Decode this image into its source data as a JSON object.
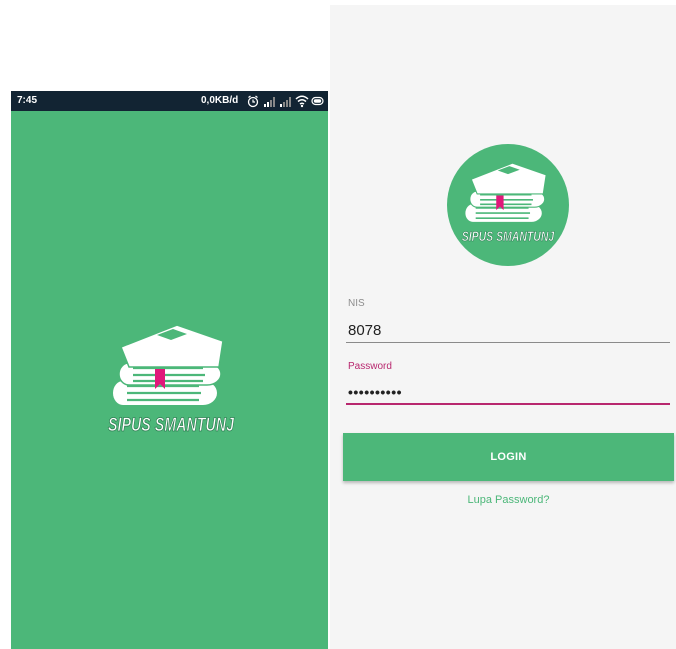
{
  "splash": {
    "status_bar": {
      "time": "7:45",
      "net_speed": "0,0KB/d",
      "icons": [
        "alarm-icon",
        "signal-icon",
        "signal-icon",
        "wifi-icon",
        "battery-icon"
      ]
    },
    "logo_text": "SIPUS SMANTUNJ",
    "background": "#4cb779"
  },
  "login": {
    "logo_text": "SIPUS SMANTUNJ",
    "nis": {
      "label": "NIS",
      "value": "8078"
    },
    "password": {
      "label": "Password",
      "value": "••••••••••"
    },
    "login_button": "LOGIN",
    "forgot_link": "Lupa Password?"
  },
  "colors": {
    "brand_green": "#4cb779",
    "accent_pink": "#b8276e",
    "statusbar": "#122433",
    "bookmark": "#e0187a"
  }
}
